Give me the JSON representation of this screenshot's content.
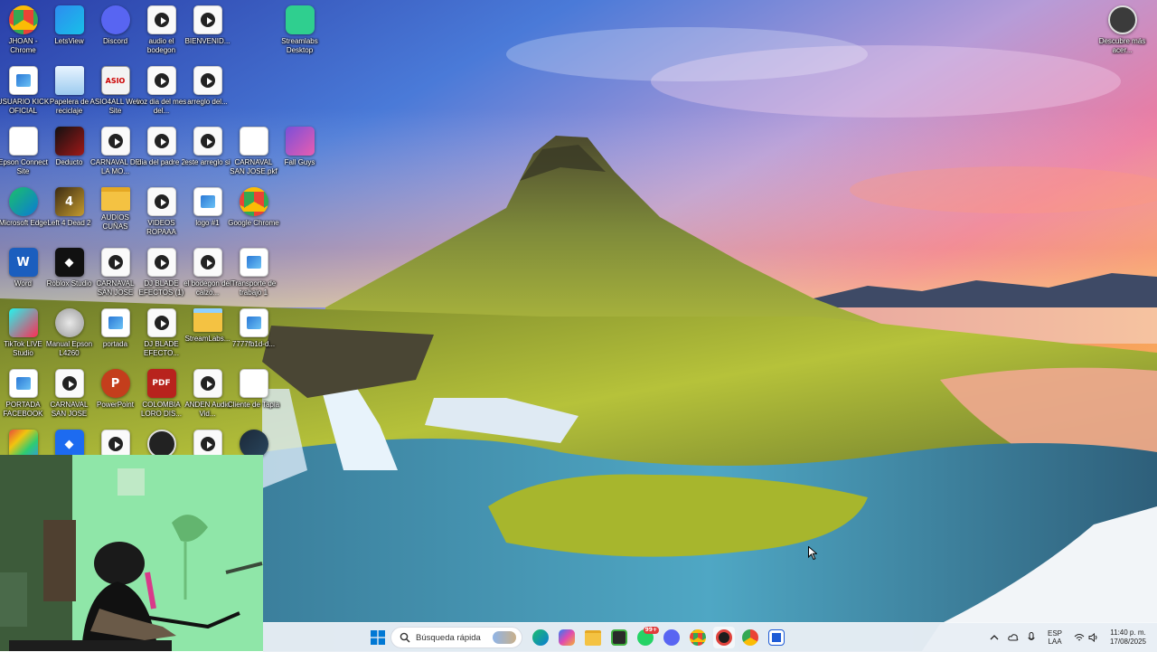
{
  "desktop": {
    "icons": [
      {
        "label": "JHOAN - Chrome",
        "icon": "chrome-icon",
        "style": "chrome"
      },
      {
        "label": "LetsView",
        "icon": "letsview-icon",
        "style": "letsview"
      },
      {
        "label": "Discord",
        "icon": "discord-icon",
        "style": "discord"
      },
      {
        "label": "audio el bodegon",
        "icon": "video-file-icon",
        "style": "video"
      },
      {
        "label": "BIENVENID...",
        "icon": "video-file-icon",
        "style": "video"
      },
      {
        "label": "Streamlabs Desktop",
        "icon": "streamlabs-icon",
        "style": "streamlabs"
      },
      {
        "label": "USUARIO KICK OFICIAL",
        "icon": "image-file-icon",
        "style": "image"
      },
      {
        "label": "Papelera de reciclaje",
        "icon": "recycle-bin-icon",
        "style": "recycle"
      },
      {
        "label": "ASIO4ALL Web Site",
        "icon": "asio-icon",
        "style": "asio"
      },
      {
        "label": "voz dia del mes del...",
        "icon": "video-file-icon",
        "style": "video"
      },
      {
        "label": "arreglo del...",
        "icon": "video-file-icon",
        "style": "video"
      },
      {
        "label": "Epson Connect Site",
        "icon": "chrome-icon",
        "style": "chrome-small"
      },
      {
        "label": "Deducto",
        "icon": "deducto-icon",
        "style": "deducto"
      },
      {
        "label": "CARNAVAL DE LA MO...",
        "icon": "video-file-icon",
        "style": "video"
      },
      {
        "label": "dia del padre 2",
        "icon": "video-file-icon",
        "style": "video"
      },
      {
        "label": "este arreglo si",
        "icon": "video-file-icon",
        "style": "video"
      },
      {
        "label": "CARNAVAL SAN JOSE.pkf",
        "icon": "document-icon",
        "style": "doc"
      },
      {
        "label": "Fall Guys",
        "icon": "fall-guys-icon",
        "style": "fallguys"
      },
      {
        "label": "Microsoft Edge",
        "icon": "edge-icon",
        "style": "edge"
      },
      {
        "label": "Left 4 Dead 2",
        "icon": "l4d2-icon",
        "style": "l4d2"
      },
      {
        "label": "AUDIOS CUÑAS",
        "icon": "folder-icon",
        "style": "folder"
      },
      {
        "label": "VIDEOS ROPAAA",
        "icon": "video-file-icon",
        "style": "video"
      },
      {
        "label": "logo #1",
        "icon": "image-file-icon",
        "style": "image"
      },
      {
        "label": "Google Chrome",
        "icon": "chrome-icon",
        "style": "chrome"
      },
      {
        "label": "Word",
        "icon": "word-icon",
        "style": "word"
      },
      {
        "label": "Roblox Studio",
        "icon": "roblox-studio-icon",
        "style": "roblox"
      },
      {
        "label": "CARNAVAL SAN JOSE",
        "icon": "video-file-icon",
        "style": "video"
      },
      {
        "label": "DJ BLADE EFECTOS (1)",
        "icon": "video-file-icon",
        "style": "video"
      },
      {
        "label": "el bodegon del calzo...",
        "icon": "video-file-icon",
        "style": "video"
      },
      {
        "label": "Transporte de trabajo 1",
        "icon": "image-file-icon",
        "style": "image"
      },
      {
        "label": "TikTok LIVE Studio",
        "icon": "tiktok-icon",
        "style": "tiktok"
      },
      {
        "label": "Manual Epson L4260",
        "icon": "manual-icon",
        "style": "manual"
      },
      {
        "label": "portada",
        "icon": "image-file-icon",
        "style": "image"
      },
      {
        "label": "DJ BLADE EFECTO...",
        "icon": "video-file-icon",
        "style": "video"
      },
      {
        "label": "StreamLabs...",
        "icon": "streamlabs-folder-icon",
        "style": "slfolder"
      },
      {
        "label": "7777fb1d-d...",
        "icon": "image-file-icon",
        "style": "image"
      },
      {
        "label": "PORTADA FACEBOOK",
        "icon": "image-file-icon",
        "style": "image"
      },
      {
        "label": "CARNAVAL SAN JOSE",
        "icon": "video-file-icon",
        "style": "video"
      },
      {
        "label": "PowerPoint",
        "icon": "powerpoint-icon",
        "style": "ppt"
      },
      {
        "label": "COLOMBIA LORO DIS...",
        "icon": "pdf-icon",
        "style": "pdf"
      },
      {
        "label": "ANDEN Audio Vid...",
        "icon": "video-file-icon",
        "style": "video"
      },
      {
        "label": "Cliente de Tapia",
        "icon": "document-icon",
        "style": "doc"
      },
      {
        "label": "",
        "icon": "app-grid-icon",
        "style": "grid"
      },
      {
        "label": "",
        "icon": "roblox-icon",
        "style": "roblox-blue"
      },
      {
        "label": "",
        "icon": "video-file-icon",
        "style": "video"
      },
      {
        "label": "",
        "icon": "obs-icon",
        "style": "obs"
      },
      {
        "label": "",
        "icon": "video-file-icon",
        "style": "video"
      },
      {
        "label": "",
        "icon": "steam-icon",
        "style": "steam"
      },
      {
        "label": "Descubre más acer...",
        "icon": "discover-icon",
        "style": "discover"
      }
    ]
  },
  "taskbar": {
    "search_placeholder": "Búsqueda rápida",
    "discord_badge": "99+",
    "lang_line1": "ESP",
    "lang_line2": "LAA",
    "time": "11:40 p. m.",
    "date": "17/08/2025"
  },
  "colors": {
    "accent": "#0067c0",
    "taskbar": "#e8eef5"
  }
}
